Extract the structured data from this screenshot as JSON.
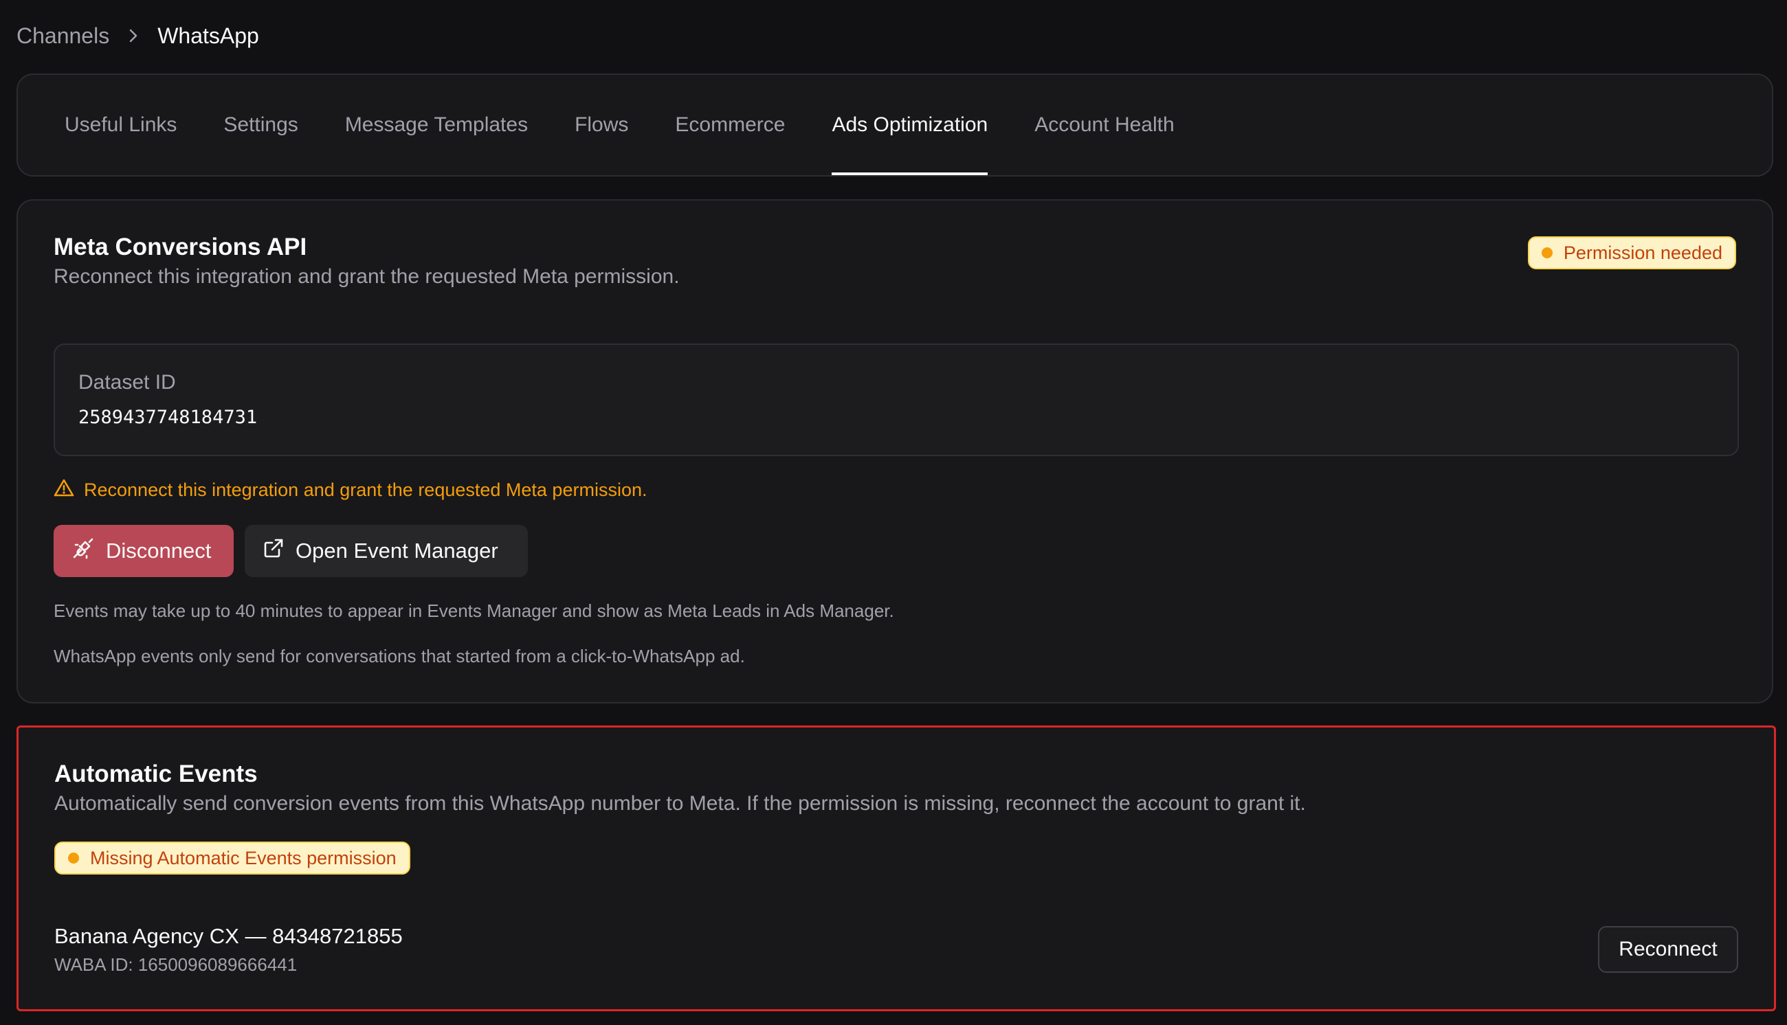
{
  "breadcrumb": {
    "parent": "Channels",
    "current": "WhatsApp"
  },
  "tabs": [
    {
      "label": "Useful Links",
      "active": false
    },
    {
      "label": "Settings",
      "active": false
    },
    {
      "label": "Message Templates",
      "active": false
    },
    {
      "label": "Flows",
      "active": false
    },
    {
      "label": "Ecommerce",
      "active": false
    },
    {
      "label": "Ads Optimization",
      "active": true
    },
    {
      "label": "Account Health",
      "active": false
    }
  ],
  "meta_card": {
    "title": "Meta Conversions API",
    "description": "Reconnect this integration and grant the requested Meta permission.",
    "badge": "Permission needed",
    "dataset_label": "Dataset ID",
    "dataset_value": "2589437748184731",
    "warning": "Reconnect this integration and grant the requested Meta permission.",
    "disconnect_label": "Disconnect",
    "open_event_manager_label": "Open Event Manager",
    "note_1": "Events may take up to 40 minutes to appear in Events Manager and show as Meta Leads in Ads Manager.",
    "note_2": "WhatsApp events only send for conversations that started from a click-to-WhatsApp ad."
  },
  "auto_card": {
    "title": "Automatic Events",
    "description": "Automatically send conversion events from this WhatsApp number to Meta. If the permission is missing, reconnect the account to grant it.",
    "badge": "Missing Automatic Events permission",
    "account_name": "Banana Agency CX — 84348721855",
    "waba_id": "WABA ID: 1650096089666441",
    "reconnect_label": "Reconnect"
  },
  "colors": {
    "background": "#111113",
    "card": "#18181b",
    "warning": "#f59e0b",
    "danger_button": "#b84855",
    "highlight_border": "#dc2626"
  }
}
